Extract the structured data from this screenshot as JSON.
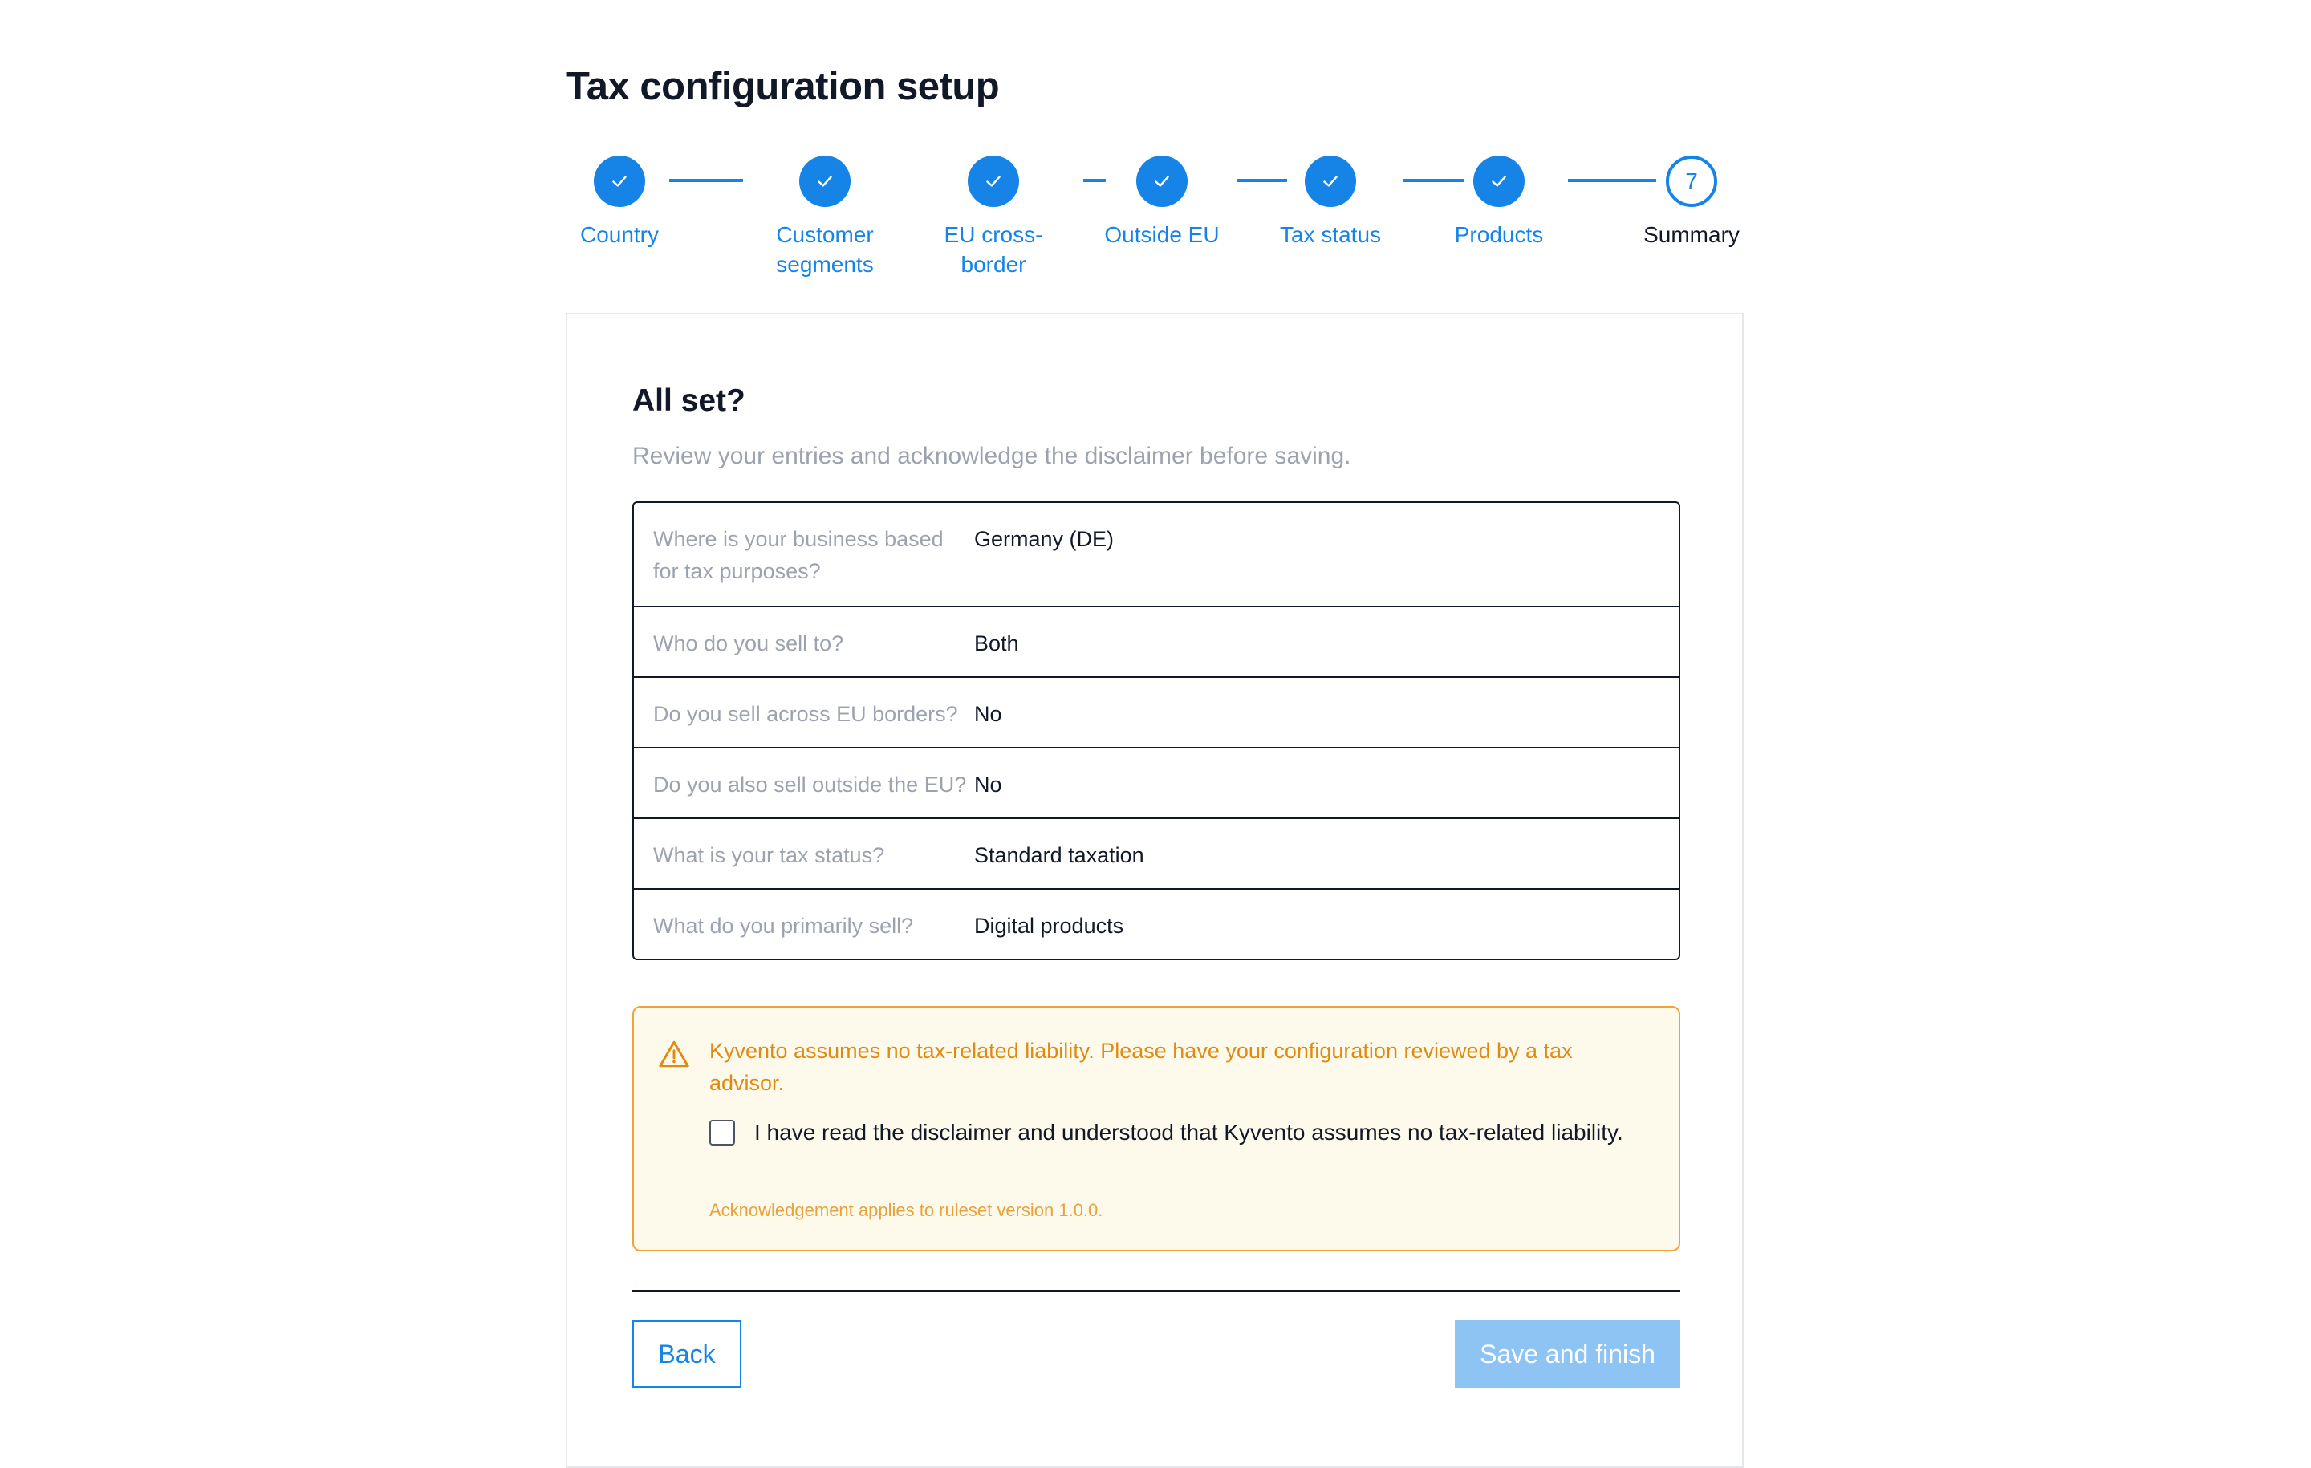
{
  "page": {
    "title": "Tax configuration setup"
  },
  "colors": {
    "accent": "#1684e6",
    "warning": "#e08a12",
    "warning_bg": "#fefaeb",
    "disabled_button": "#8dc4f4"
  },
  "stepper": {
    "steps": [
      {
        "label": "Country",
        "status": "completed",
        "icon": "check-icon"
      },
      {
        "label": "Customer segments",
        "status": "completed",
        "icon": "check-icon"
      },
      {
        "label": "EU cross-border",
        "status": "completed",
        "icon": "check-icon"
      },
      {
        "label": "Outside EU",
        "status": "completed",
        "icon": "check-icon"
      },
      {
        "label": "Tax status",
        "status": "completed",
        "icon": "check-icon"
      },
      {
        "label": "Products",
        "status": "completed",
        "icon": "check-icon"
      },
      {
        "label": "Summary",
        "status": "current",
        "number": "7"
      }
    ]
  },
  "card": {
    "heading": "All set?",
    "subtitle": "Review your entries and acknowledge the disclaimer before saving."
  },
  "summary": {
    "rows": [
      {
        "question": "Where is your business based for tax purposes?",
        "answer": "Germany (DE)"
      },
      {
        "question": "Who do you sell to?",
        "answer": "Both"
      },
      {
        "question": "Do you sell across EU borders?",
        "answer": "No"
      },
      {
        "question": "Do you also sell outside the EU?",
        "answer": "No"
      },
      {
        "question": "What is your tax status?",
        "answer": "Standard taxation"
      },
      {
        "question": "What do you primarily sell?",
        "answer": "Digital products"
      }
    ]
  },
  "disclaimer": {
    "icon": "warning-triangle-icon",
    "text": "Kyvento assumes no tax-related liability. Please have your configuration reviewed by a tax advisor.",
    "checkbox_label": "I have read the disclaimer and understood that Kyvento assumes no tax-related liability.",
    "checkbox_checked": false,
    "note": "Acknowledgement applies to ruleset version 1.0.0."
  },
  "actions": {
    "back_label": "Back",
    "save_label": "Save and finish",
    "save_disabled": true
  }
}
